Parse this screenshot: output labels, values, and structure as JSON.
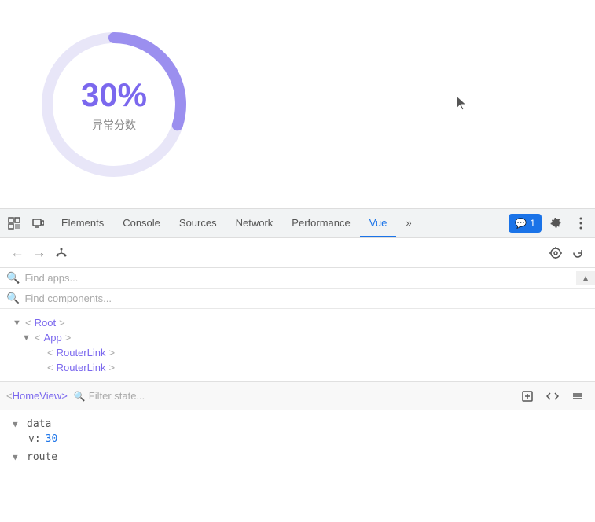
{
  "chart": {
    "percent": "30%",
    "label": "异常分数",
    "value": 30,
    "total": 100,
    "color_fill": "#9b8fef",
    "color_track": "#e8e6f8",
    "radius": 85,
    "stroke_width": 14
  },
  "devtools": {
    "tabs": [
      {
        "id": "elements",
        "label": "Elements",
        "active": false
      },
      {
        "id": "console",
        "label": "Console",
        "active": false
      },
      {
        "id": "sources",
        "label": "Sources",
        "active": false
      },
      {
        "id": "network",
        "label": "Network",
        "active": false
      },
      {
        "id": "performance",
        "label": "Performance",
        "active": false
      },
      {
        "id": "vue",
        "label": "Vue",
        "active": true
      }
    ],
    "more_tabs": "»",
    "badge_count": "1",
    "badge_icon": "💬"
  },
  "vue_panel": {
    "find_apps_placeholder": "Find apps...",
    "find_components_placeholder": "Find components...",
    "component_tree": [
      {
        "indent": 0,
        "arrow": "▼",
        "tag": "<Root>"
      },
      {
        "indent": 1,
        "arrow": "▼",
        "tag": "<App>"
      },
      {
        "indent": 2,
        "arrow": "",
        "tag": "<RouterLink>"
      },
      {
        "indent": 2,
        "arrow": "",
        "tag": "<RouterLink>"
      }
    ],
    "selected_component": "<HomeView>",
    "filter_placeholder": "Filter state...",
    "data_section": {
      "key": "data",
      "children": [
        {
          "key": "v",
          "value": "30",
          "type": "number"
        }
      ]
    },
    "route_key": "route"
  }
}
